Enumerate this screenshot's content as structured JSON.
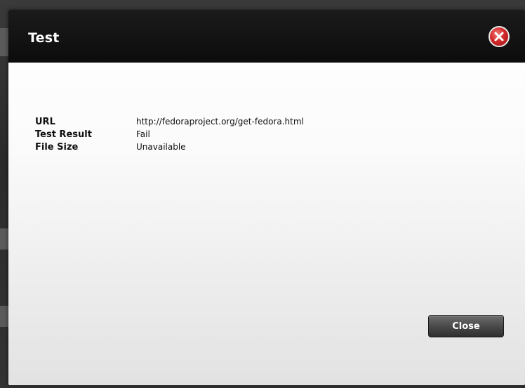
{
  "dialog": {
    "title": "Test",
    "close_icon": "close-x-icon",
    "accent_color": "#d42a2a"
  },
  "fields": [
    {
      "label": "URL",
      "value": "http://fedoraproject.org/get-fedora.html"
    },
    {
      "label": "Test Result",
      "value": "Fail"
    },
    {
      "label": "File Size",
      "value": "Unavailable"
    }
  ],
  "footer": {
    "close_label": "Close"
  }
}
